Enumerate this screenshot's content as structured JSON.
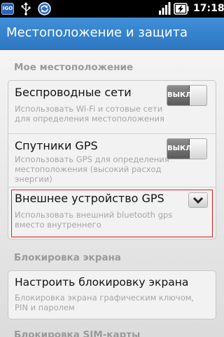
{
  "statusbar": {
    "app_icon_text": "IGO",
    "time": "17:18"
  },
  "titlebar": {
    "title": "Местоположение и защита"
  },
  "sections": {
    "location_header": "Мое местоположение",
    "screen_lock_header": "Блокировка экрана",
    "sim_lock_header": "Блокировка SIM-карты"
  },
  "location_items": [
    {
      "title": "Беспроводные сети",
      "summary": "Использовать Wi-Fi и сотовые сети для определения местоположения",
      "toggle_label": "ВЫКЛ"
    },
    {
      "title": "Спутники GPS",
      "summary": "Использовать GPS для определения местоположения (высокий расход энергии)",
      "toggle_label": "ВЫКЛ"
    },
    {
      "title": "Внешнее устройство GPS",
      "summary": "Использовать внешний bluetooth gps вместо внутреннего"
    }
  ],
  "screen_lock_item": {
    "title": "Настроить блокировку экрана",
    "summary": "Блокировка экрана графическим ключом, PIN и паролем"
  },
  "colors": {
    "titlebar": "#3a87d2",
    "highlight_border": "#e02020"
  }
}
